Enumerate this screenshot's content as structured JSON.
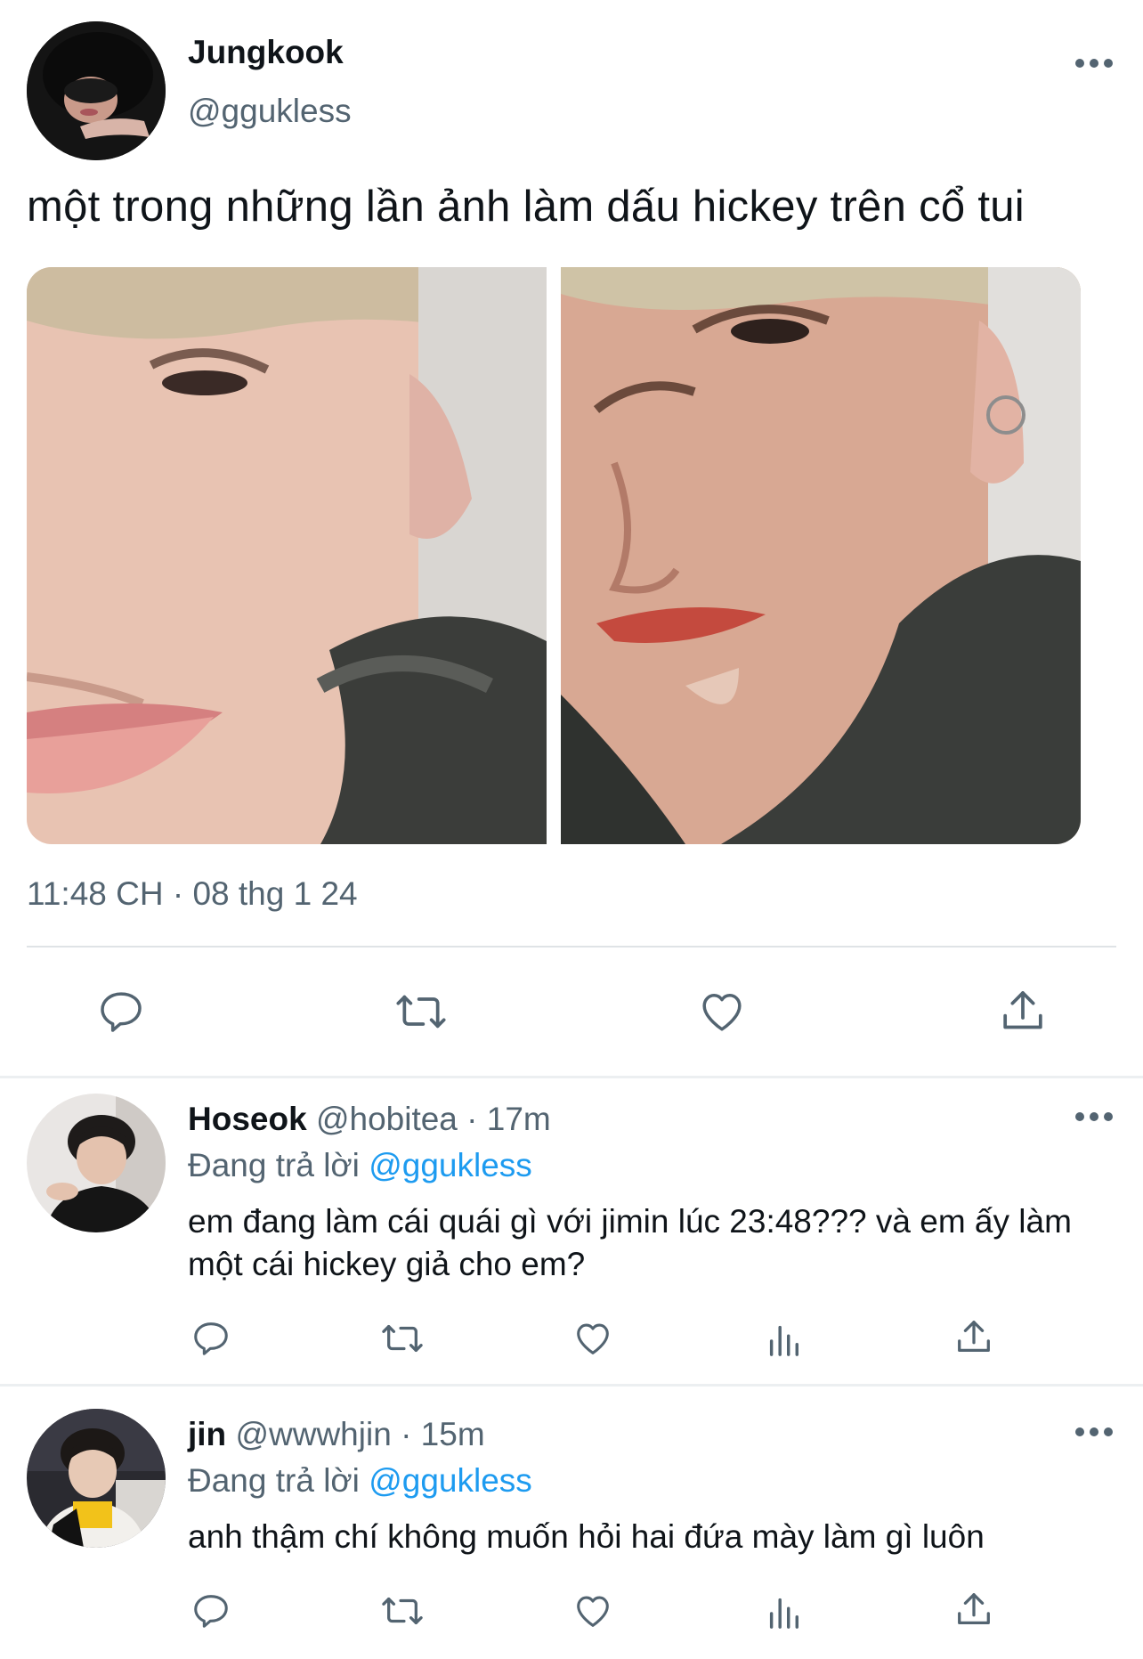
{
  "tweet": {
    "author_name": "Jungkook",
    "author_handle": "@ggukless",
    "text": "một trong những lần ảnh làm dấu hickey trên cổ tui",
    "timestamp": "11:48 CH · 08 thg 1 24",
    "actions": [
      "reply-icon",
      "retweet-icon",
      "like-icon",
      "share-icon"
    ]
  },
  "replies": [
    {
      "name": "Hoseok",
      "handle": "@hobitea",
      "separator": "·",
      "time": "17m",
      "replying_prefix": "Đang trả lời",
      "replying_to": "@ggukless",
      "text": "em đang làm cái quái gì với jimin lúc 23:48??? và em ấy làm một cái hickey giả cho em?"
    },
    {
      "name": "jin",
      "handle": "@wwwhjin",
      "separator": "·",
      "time": "15m",
      "replying_prefix": "Đang trả lời",
      "replying_to": "@ggukless",
      "text": "anh thậm chí không muốn hỏi hai đứa mày làm gì luôn"
    }
  ],
  "colors": {
    "text": "#0f1419",
    "secondary": "#536471",
    "link": "#1d9bf0",
    "divider": "#dfe3e6"
  }
}
